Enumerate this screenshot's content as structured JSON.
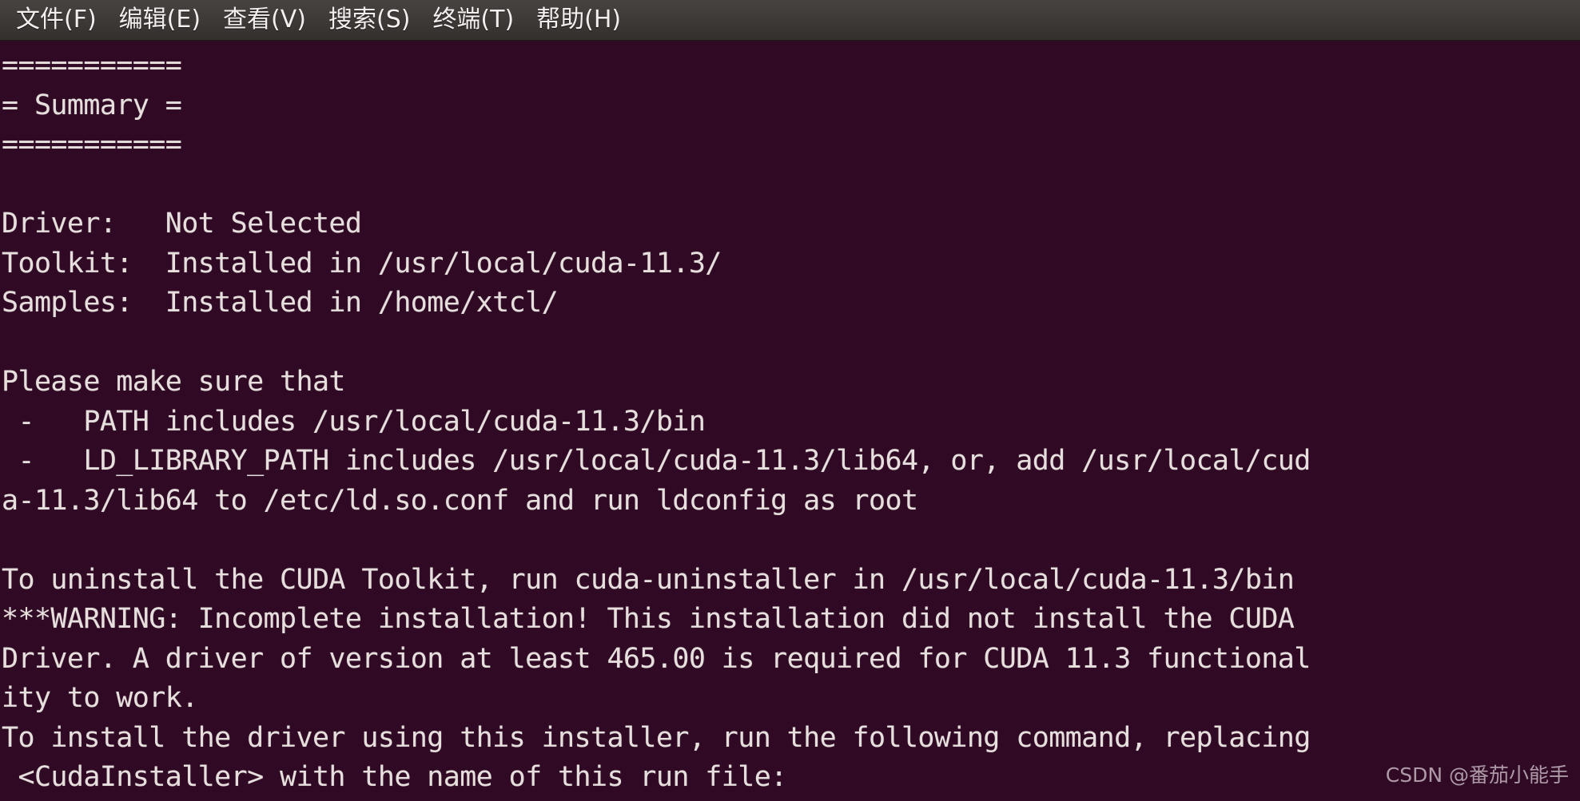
{
  "window": {
    "app": "gnome-terminal",
    "background_color": "#300a24",
    "foreground_color": "#e6dfdd",
    "menubar_color": "#3c3836"
  },
  "menubar": {
    "items": [
      {
        "label": "文件(F)",
        "name": "menu-file"
      },
      {
        "label": "编辑(E)",
        "name": "menu-edit"
      },
      {
        "label": "查看(V)",
        "name": "menu-view"
      },
      {
        "label": "搜索(S)",
        "name": "menu-search"
      },
      {
        "label": "终端(T)",
        "name": "menu-terminal"
      },
      {
        "label": "帮助(H)",
        "name": "menu-help"
      }
    ]
  },
  "terminal": {
    "lines": [
      "===========",
      "= Summary =",
      "===========",
      "",
      "Driver:   Not Selected",
      "Toolkit:  Installed in /usr/local/cuda-11.3/",
      "Samples:  Installed in /home/xtcl/",
      "",
      "Please make sure that",
      " -   PATH includes /usr/local/cuda-11.3/bin",
      " -   LD_LIBRARY_PATH includes /usr/local/cuda-11.3/lib64, or, add /usr/local/cud",
      "a-11.3/lib64 to /etc/ld.so.conf and run ldconfig as root",
      "",
      "To uninstall the CUDA Toolkit, run cuda-uninstaller in /usr/local/cuda-11.3/bin",
      "***WARNING: Incomplete installation! This installation did not install the CUDA",
      "Driver. A driver of version at least 465.00 is required for CUDA 11.3 functional",
      "ity to work.",
      "To install the driver using this installer, run the following command, replacing",
      " <CudaInstaller> with the name of this run file:"
    ]
  },
  "watermark": {
    "text": "CSDN @番茄小能手"
  }
}
